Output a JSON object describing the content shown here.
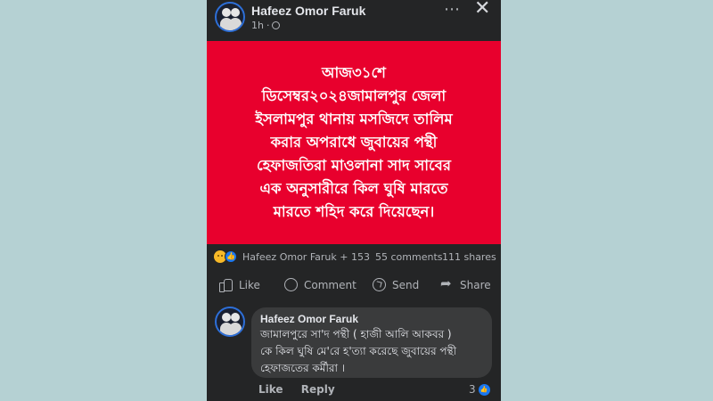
{
  "post": {
    "author": "Hafeez Omor Faruk",
    "time": "1h",
    "time_separator": "·",
    "more_icon": "⋯",
    "close_icon": "✕",
    "text": "আজ৩১শে\nডিসেম্বর২০২৪জামালপুর জেলা\nইসলামপুর থানায় মসজিদে তালিম\nকরার অপরাধে জুবায়ের পন্থী\nহেফাজতিরা মাওলানা সাদ সাবের\nএক অনুসারীরে কিল ঘুষি মারতে\nমারতে শহিদ করে দিয়েছেন।",
    "background_color": "#e8002d"
  },
  "reactions": {
    "reactors": "Hafeez Omor Faruk + 153",
    "comments": "55 comments",
    "shares": "111 shares"
  },
  "actions": {
    "like": "Like",
    "comment": "Comment",
    "send": "Send",
    "share": "Share"
  },
  "comment": {
    "author": "Hafeez Omor Faruk",
    "text": "জামালপুরে সা'দ পন্থী ( হাজী আলি আকবর )\nকে কিল ঘুষি মে'রে হ'ত্যা করেছে জুবায়ের পন্থী\nহেফাজতের কর্মীরা ।",
    "like_label": "Like",
    "reply_label": "Reply",
    "like_count": "3"
  },
  "icons": [
    "globe-icon",
    "more-icon",
    "close-icon",
    "sad-reaction-icon",
    "like-reaction-icon",
    "like-icon",
    "comment-icon",
    "send-icon",
    "share-icon"
  ]
}
